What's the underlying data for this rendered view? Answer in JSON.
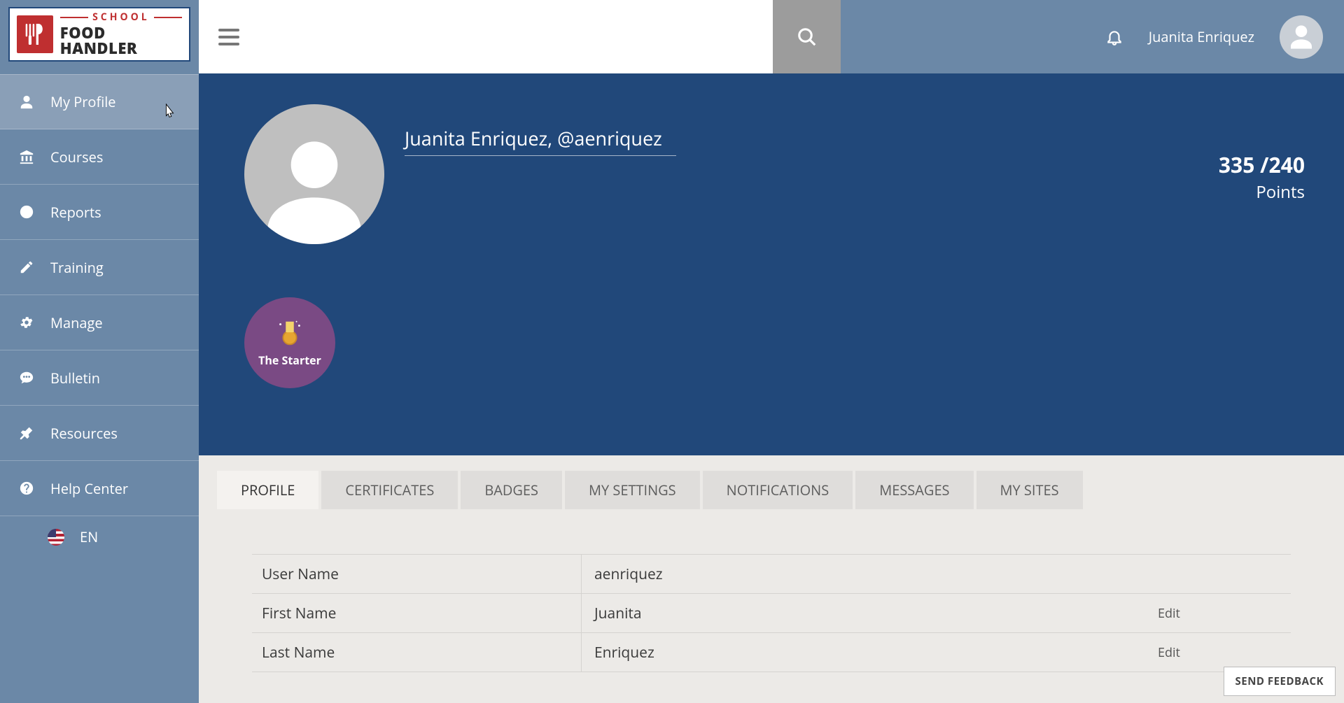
{
  "brand": {
    "line1": "SCHOOL",
    "line2": "FOOD HANDLER"
  },
  "sidebar": {
    "items": [
      {
        "label": "My Profile"
      },
      {
        "label": "Courses"
      },
      {
        "label": "Reports"
      },
      {
        "label": "Training"
      },
      {
        "label": "Manage"
      },
      {
        "label": "Bulletin"
      },
      {
        "label": "Resources"
      },
      {
        "label": "Help Center"
      }
    ],
    "language": "EN"
  },
  "header": {
    "user_name": "Juanita Enriquez"
  },
  "hero": {
    "user_title": "Juanita Enriquez, @aenriquez",
    "points_value": "335 /240",
    "points_label": "Points",
    "badge_label": "The Starter"
  },
  "tabs": [
    {
      "label": "PROFILE"
    },
    {
      "label": "CERTIFICATES"
    },
    {
      "label": "BADGES"
    },
    {
      "label": "MY SETTINGS"
    },
    {
      "label": "NOTIFICATIONS"
    },
    {
      "label": "MESSAGES"
    },
    {
      "label": "MY SITES"
    }
  ],
  "profile_rows": [
    {
      "label": "User Name",
      "value": "aenriquez",
      "edit": ""
    },
    {
      "label": "First Name",
      "value": "Juanita",
      "edit": "Edit"
    },
    {
      "label": "Last Name",
      "value": "Enriquez",
      "edit": "Edit"
    }
  ],
  "feedback_button": "SEND FEEDBACK"
}
